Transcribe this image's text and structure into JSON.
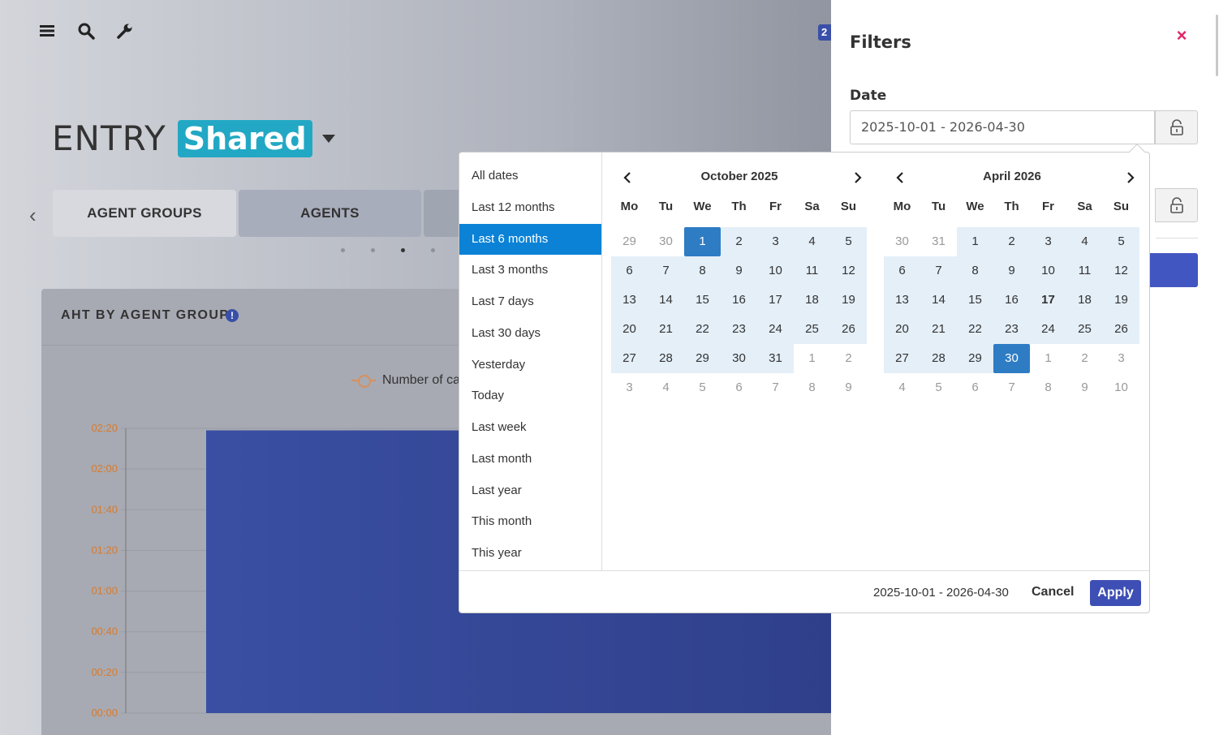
{
  "topbar": {
    "icons": [
      "menu-icon",
      "search-icon",
      "wrench-icon"
    ]
  },
  "header": {
    "title": "ENTRY",
    "chip": "Shared",
    "badge_peek": "2"
  },
  "tabs": [
    {
      "label": "AGENT GROUPS"
    },
    {
      "label": "AGENTS"
    },
    {
      "label": ""
    }
  ],
  "card": {
    "title": "AHT BY AGENT GROUP",
    "info": "!",
    "legend_label": "Number of ca"
  },
  "chart_data": {
    "type": "bar",
    "ylabels": [
      "02:20",
      "02:00",
      "01:40",
      "01:20",
      "01:00",
      "00:40",
      "00:20",
      "00:00"
    ],
    "yvalues_sec": [
      140,
      120,
      100,
      80,
      60,
      40,
      20,
      0
    ],
    "ylim_sec": [
      0,
      140
    ],
    "series": [
      {
        "values_sec": [
          139
        ]
      }
    ],
    "colors": {
      "bar": "#34479c",
      "tick": "#d97a2b"
    }
  },
  "filters": {
    "title": "Filters",
    "close": "×",
    "date_label": "Date",
    "date_value": "2025-10-01 - 2026-04-30"
  },
  "picker": {
    "ranges": [
      "All dates",
      "Last 12 months",
      "Last 6 months",
      "Last 3 months",
      "Last 7 days",
      "Last 30 days",
      "Yesterday",
      "Today",
      "Last week",
      "Last month",
      "Last year",
      "This month",
      "This year"
    ],
    "active_range": 2,
    "weekdays": [
      "Mo",
      "Tu",
      "We",
      "Th",
      "Fr",
      "Sa",
      "Su"
    ],
    "calendars": [
      {
        "month": "October 2025",
        "days": [
          [
            "29",
            "off"
          ],
          [
            "30",
            "off"
          ],
          [
            "1",
            "sel"
          ],
          [
            "2",
            "in"
          ],
          [
            "3",
            "in"
          ],
          [
            "4",
            "in"
          ],
          [
            "5",
            "in"
          ],
          [
            "6",
            "in"
          ],
          [
            "7",
            "in"
          ],
          [
            "8",
            "in"
          ],
          [
            "9",
            "in"
          ],
          [
            "10",
            "in"
          ],
          [
            "11",
            "in"
          ],
          [
            "12",
            "in"
          ],
          [
            "13",
            "in"
          ],
          [
            "14",
            "in"
          ],
          [
            "15",
            "in"
          ],
          [
            "16",
            "in"
          ],
          [
            "17",
            "in"
          ],
          [
            "18",
            "in"
          ],
          [
            "19",
            "in"
          ],
          [
            "20",
            "in"
          ],
          [
            "21",
            "in"
          ],
          [
            "22",
            "in"
          ],
          [
            "23",
            "in"
          ],
          [
            "24",
            "in"
          ],
          [
            "25",
            "in"
          ],
          [
            "26",
            "in"
          ],
          [
            "27",
            "in"
          ],
          [
            "28",
            "in"
          ],
          [
            "29",
            "in"
          ],
          [
            "30",
            "in"
          ],
          [
            "31",
            "in"
          ],
          [
            "1",
            "off"
          ],
          [
            "2",
            "off"
          ],
          [
            "3",
            "off"
          ],
          [
            "4",
            "off"
          ],
          [
            "5",
            "off"
          ],
          [
            "6",
            "off"
          ],
          [
            "7",
            "off"
          ],
          [
            "8",
            "off"
          ],
          [
            "9",
            "off"
          ]
        ]
      },
      {
        "month": "April 2026",
        "days": [
          [
            "30",
            "off"
          ],
          [
            "31",
            "off"
          ],
          [
            "1",
            "in"
          ],
          [
            "2",
            "in"
          ],
          [
            "3",
            "in"
          ],
          [
            "4",
            "in"
          ],
          [
            "5",
            "in"
          ],
          [
            "6",
            "in"
          ],
          [
            "7",
            "in"
          ],
          [
            "8",
            "in"
          ],
          [
            "9",
            "in"
          ],
          [
            "10",
            "in"
          ],
          [
            "11",
            "in"
          ],
          [
            "12",
            "in"
          ],
          [
            "13",
            "in"
          ],
          [
            "14",
            "in"
          ],
          [
            "15",
            "in"
          ],
          [
            "16",
            "in"
          ],
          [
            "17",
            "in today"
          ],
          [
            "18",
            "in"
          ],
          [
            "19",
            "in"
          ],
          [
            "20",
            "in"
          ],
          [
            "21",
            "in"
          ],
          [
            "22",
            "in"
          ],
          [
            "23",
            "in"
          ],
          [
            "24",
            "in"
          ],
          [
            "25",
            "in"
          ],
          [
            "26",
            "in"
          ],
          [
            "27",
            "in"
          ],
          [
            "28",
            "in"
          ],
          [
            "29",
            "in"
          ],
          [
            "30",
            "sel"
          ],
          [
            "1",
            "off"
          ],
          [
            "2",
            "off"
          ],
          [
            "3",
            "off"
          ],
          [
            "4",
            "off"
          ],
          [
            "5",
            "off"
          ],
          [
            "6",
            "off"
          ],
          [
            "7",
            "off"
          ],
          [
            "8",
            "off"
          ],
          [
            "9",
            "off"
          ],
          [
            "10",
            "off"
          ]
        ]
      }
    ],
    "footer_range": "2025-10-01 - 2026-04-30",
    "cancel_label": "Cancel",
    "apply_label": "Apply"
  }
}
